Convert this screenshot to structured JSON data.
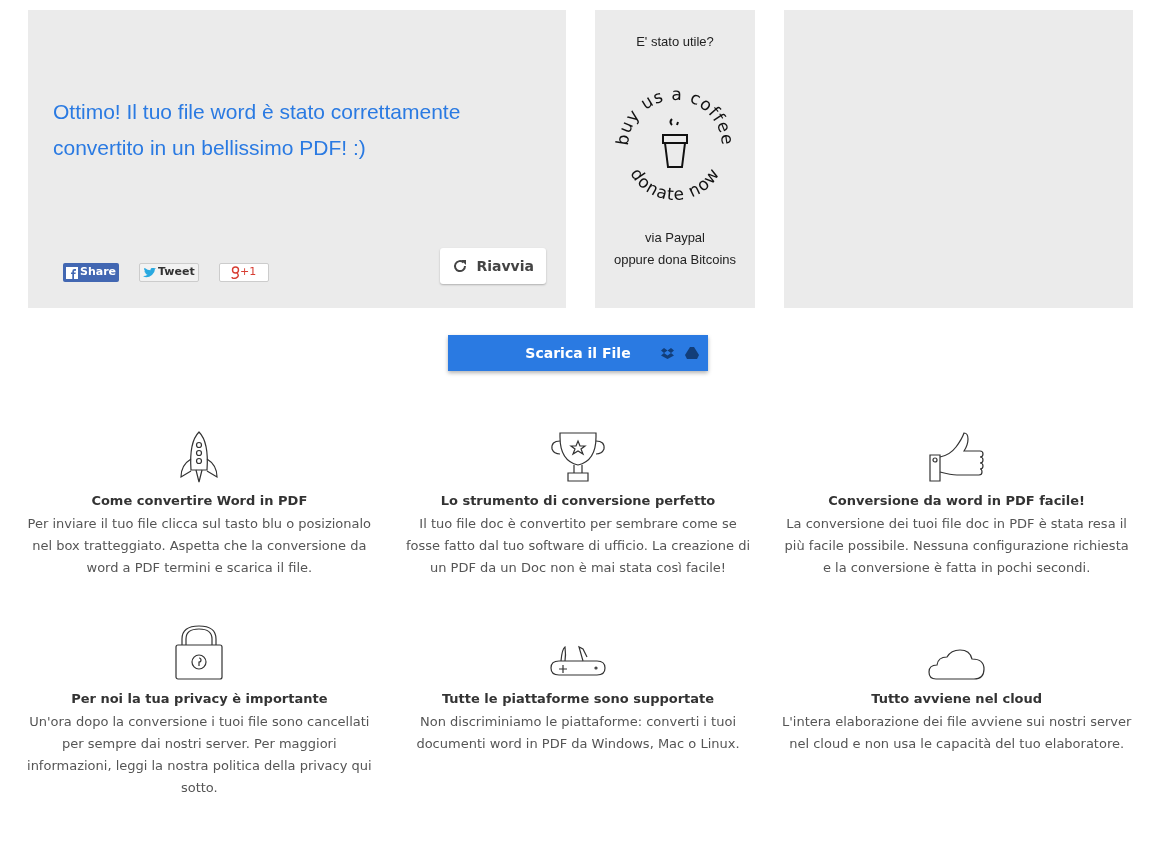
{
  "result": {
    "message": "Ottimo! Il tuo file word è stato correttamente convertito in un bellissimo PDF! :)",
    "share_buttons": [
      {
        "kind": "facebook",
        "label": "Share"
      },
      {
        "kind": "twitter",
        "label": "Tweet"
      },
      {
        "kind": "gplus",
        "label": "+1"
      }
    ],
    "restart_button": "Riavvia"
  },
  "donate": {
    "question": "E' stato utile?",
    "badge_top": "buy us a coffee",
    "badge_bottom": "donate now",
    "line_1": "via Paypal",
    "line_2": "oppure dona Bitcoins"
  },
  "download_button": "Scarica il File",
  "features": [
    {
      "kind": "rocket",
      "title": "Come convertire Word in PDF",
      "text": "Per inviare il tuo file clicca sul tasto blu o posizionalo nel box tratteggiato. Aspetta che la conversione da word a PDF termini e scarica il file."
    },
    {
      "kind": "trophy",
      "title": "Lo strumento di conversione perfetto",
      "text": "Il tuo file doc è convertito per sembrare come se fosse fatto dal tuo software di ufficio. La creazione di un PDF da un Doc non è mai stata così facile!"
    },
    {
      "kind": "thumb",
      "title": "Conversione da word in PDF facile!",
      "text": "La conversione dei tuoi file doc in PDF è stata resa il più facile possibile. Nessuna configurazione richiesta e la conversione è fatta in pochi secondi."
    },
    {
      "kind": "lock",
      "title": "Per noi la tua privacy è importante",
      "text": "Un'ora dopo la conversione i tuoi file sono cancellati per sempre dai nostri server. Per maggiori informazioni, leggi la nostra politica della privacy qui sotto."
    },
    {
      "kind": "knife",
      "title": "Tutte le piattaforme sono supportate",
      "text": "Non discriminiamo le piattaforme: converti i tuoi documenti word in PDF da Windows, Mac o Linux."
    },
    {
      "kind": "cloud",
      "title": "Tutto avviene nel cloud",
      "text": "L'intera elaborazione dei file avviene sui nostri server nel cloud e non usa le capacità del tuo elaboratore."
    }
  ]
}
